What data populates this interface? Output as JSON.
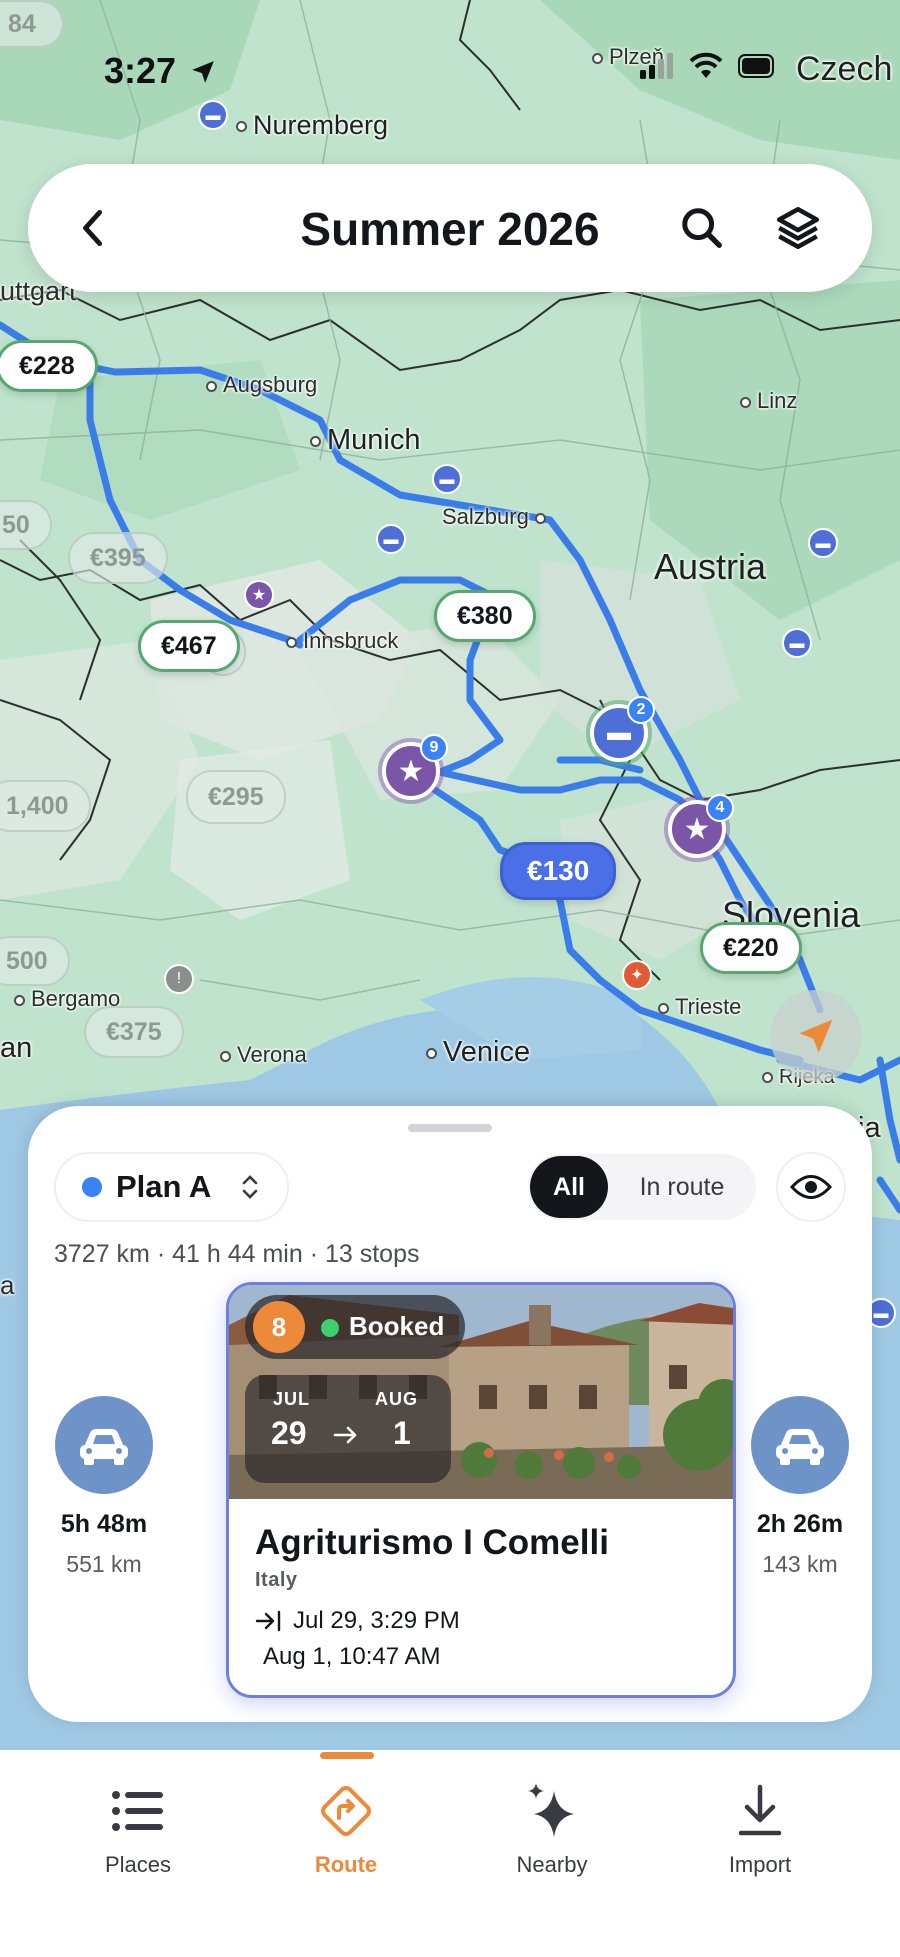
{
  "status_bar": {
    "time": "3:27"
  },
  "header": {
    "title": "Summer 2026"
  },
  "map": {
    "cities": [
      {
        "name": "Plzeň"
      },
      {
        "name": "Czech"
      },
      {
        "name": "Nuremberg"
      },
      {
        "name": "uttgart"
      },
      {
        "name": "Augsburg"
      },
      {
        "name": "Linz"
      },
      {
        "name": "Munich"
      },
      {
        "name": "Salzburg"
      },
      {
        "name": "Innsbruck"
      },
      {
        "name": "Bergamo"
      },
      {
        "name": "Verona"
      },
      {
        "name": "Venice"
      },
      {
        "name": "Trieste"
      },
      {
        "name": "Rijeka"
      },
      {
        "name": "an"
      },
      {
        "name": "ia"
      },
      {
        "name": "a"
      }
    ],
    "countries": {
      "austria": "Austria",
      "slovenia": "Slovenia"
    },
    "prices": {
      "p228": "€228",
      "p467": "€467",
      "p380": "€380",
      "p130": "€130",
      "p220": "€220",
      "p395": "€395",
      "p295": "€295",
      "p375": "€375",
      "p50": "50",
      "p1400": "1,400",
      "p500": "500",
      "p84": "84",
      "p5": "5"
    },
    "stop_badges": {
      "b9": "9",
      "b2": "2",
      "b4": "4"
    }
  },
  "sheet": {
    "plan_label": "Plan A",
    "filter_all": "All",
    "filter_in_route": "In route",
    "summary": "3727 km · 41 h 44 min · 13 stops",
    "left_leg": {
      "duration": "5h 48m",
      "distance": "551 km"
    },
    "right_leg": {
      "duration": "2h 26m",
      "distance": "143 km"
    },
    "card": {
      "stop_number": "8",
      "status": "Booked",
      "start_month": "JUL",
      "start_day": "29",
      "end_month": "AUG",
      "end_day": "1",
      "name": "Agriturismo I Comelli",
      "country": "Italy",
      "check_in": "Jul 29, 3:29 PM",
      "check_out": "Aug 1, 10:47 AM"
    }
  },
  "tabs": [
    {
      "label": "Places",
      "icon": "list-icon"
    },
    {
      "label": "Route",
      "icon": "route-icon"
    },
    {
      "label": "Nearby",
      "icon": "sparkle-icon"
    },
    {
      "label": "Import",
      "icon": "download-icon"
    }
  ],
  "colors": {
    "route": "#3a7de8",
    "accent": "#ec8a3a",
    "booked": "#3ecf6e",
    "border_green": "#57a771"
  }
}
